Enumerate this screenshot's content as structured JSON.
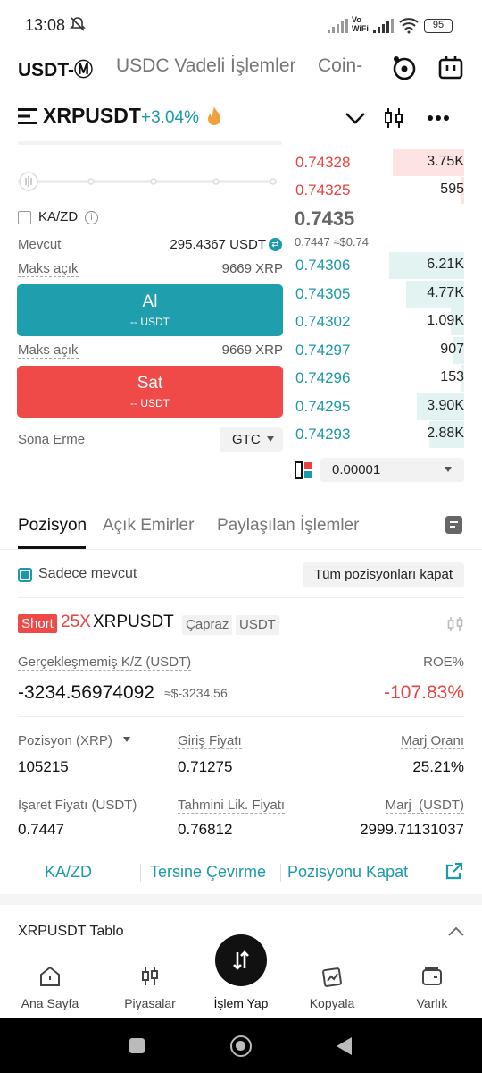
{
  "status_bar": {
    "time": "13:08",
    "network_label": "Vo\nWiFi",
    "battery": "95"
  },
  "top_tabs": [
    "USDT-Ⓜ",
    "USDC Vadeli İşlemler",
    "Coin-"
  ],
  "header": {
    "symbol": "XRPUSDT",
    "change": "+3.04%"
  },
  "order_form": {
    "kazd_label": "KA/ZD",
    "available_label": "Mevcut",
    "available_value": "295.4367 USDT",
    "max_open_label": "Maks açık",
    "max_open_value": "9669 XRP",
    "buy_label": "Al",
    "buy_sub": "-- USDT",
    "max_open_label_2": "Maks açık",
    "max_open_value_2": "9669 XRP",
    "sell_label": "Sat",
    "sell_sub": "-- USDT",
    "expiry_label": "Sona Erme",
    "expiry_value": "GTC"
  },
  "order_book": {
    "asks": [
      {
        "price": "0.74328",
        "qty": "3.75K",
        "depth": 0.95
      },
      {
        "price": "0.74325",
        "qty": "595",
        "depth": 0.05
      }
    ],
    "last_price": "0.7435",
    "mark_line": "0.7447 ≈$0.74",
    "bids": [
      {
        "price": "0.74306",
        "qty": "6.21K",
        "depth": 1.0
      },
      {
        "price": "0.74305",
        "qty": "4.77K",
        "depth": 0.77
      },
      {
        "price": "0.74302",
        "qty": "1.09K",
        "depth": 0.18
      },
      {
        "price": "0.74297",
        "qty": "907",
        "depth": 0.15
      },
      {
        "price": "0.74296",
        "qty": "153",
        "depth": 0.03
      },
      {
        "price": "0.74295",
        "qty": "3.90K",
        "depth": 0.63
      },
      {
        "price": "0.74293",
        "qty": "2.88K",
        "depth": 0.46
      }
    ],
    "precision": "0.00001"
  },
  "position_tabs": [
    "Pozisyon",
    "Açık Emirler",
    "Paylaşılan İşlemler"
  ],
  "filter": {
    "only_current": "Sadece mevcut",
    "close_all": "Tüm pozisyonları kapat"
  },
  "position": {
    "side": "Short",
    "leverage": "25X",
    "symbol": "XRPUSDT",
    "margin_mode": "Çapraz",
    "quote": "USDT",
    "upnl_label": "Gerçekleşmemiş K/Z (USDT)",
    "roe_label": "ROE%",
    "upnl_value": "-3234.56974092",
    "upnl_approx": "≈$-3234.56",
    "roe_value": "-107.83%",
    "size_label": "Pozisyon (XRP)",
    "size_value": "105215",
    "entry_label": "Giriş Fiyatı",
    "entry_value": "0.71275",
    "margin_ratio_label": "Marj Oranı",
    "margin_ratio_value": "25.21%",
    "mark_label": "İşaret Fiyatı (USDT)",
    "mark_value": "0.7447",
    "liq_label": "Tahmini Lik. Fiyatı",
    "liq_value": "0.76812",
    "margin_label": "Marj  (USDT)",
    "margin_value": "2999.71131037"
  },
  "actions": [
    "KA/ZD",
    "Tersine Çevirme",
    "Pozisyonu Kapat"
  ],
  "chart_section": "XRPUSDT Tablo",
  "bottom_nav": [
    "Ana Sayfa",
    "Piyasalar",
    "İşlem Yap",
    "Kopyala",
    "Varlık"
  ],
  "colors": {
    "teal": "#1b9aaa",
    "red": "#e84340",
    "ask_depth": "#fde3e3",
    "bid_depth": "#e3f3f2"
  }
}
